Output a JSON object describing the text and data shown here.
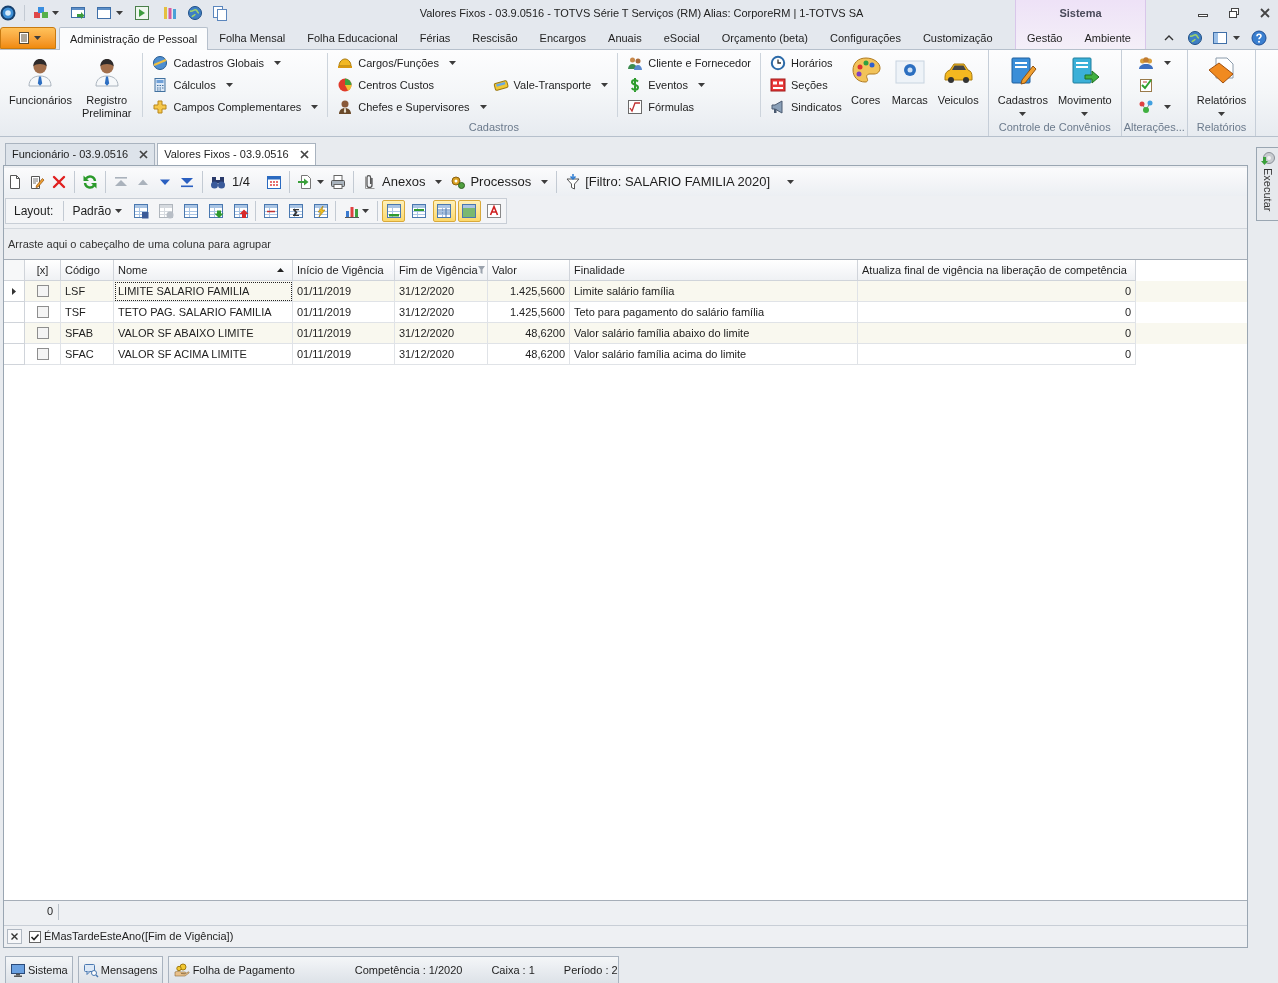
{
  "window": {
    "title": "Valores Fixos - 03.9.0516 - TOTVS Série T Serviços (RM) Alias: CorporeRM | 1-TOTVS SA"
  },
  "ribbon_tabs": [
    {
      "label": "Administração de Pessoal",
      "selected": true
    },
    {
      "label": "Folha Mensal",
      "selected": false
    },
    {
      "label": "Folha Educacional",
      "selected": false
    },
    {
      "label": "Férias",
      "selected": false
    },
    {
      "label": "Rescisão",
      "selected": false
    },
    {
      "label": "Encargos",
      "selected": false
    },
    {
      "label": "Anuais",
      "selected": false
    },
    {
      "label": "eSocial",
      "selected": false
    },
    {
      "label": "Orçamento (beta)",
      "selected": false
    },
    {
      "label": "Configurações",
      "selected": false
    },
    {
      "label": "Customização",
      "selected": false
    }
  ],
  "contextual_tab_group": {
    "label": "Sistema",
    "tabs": [
      {
        "label": "Gestão",
        "selected": false
      },
      {
        "label": "Ambiente",
        "selected": false
      }
    ]
  },
  "ribbon_groups": [
    {
      "label": "Cadastros",
      "columns": [
        {
          "kind": "large",
          "items": [
            {
              "label": "Funcionários",
              "dropdown": false
            }
          ]
        },
        {
          "kind": "large",
          "items": [
            {
              "label": "Registro Preliminar",
              "dropdown": false
            }
          ]
        },
        {
          "kind": "separator"
        },
        {
          "kind": "small",
          "items": [
            {
              "label": "Cadastros Globais",
              "dropdown": true
            },
            {
              "label": "Cálculos",
              "dropdown": true
            },
            {
              "label": "Campos Complementares",
              "dropdown": true
            }
          ]
        },
        {
          "kind": "separator"
        },
        {
          "kind": "small",
          "items": [
            {
              "label": "Cargos/Funções",
              "dropdown": true
            },
            {
              "label": "Centros Custos",
              "dropdown": false
            },
            {
              "label": "Chefes e Supervisores",
              "dropdown": true
            }
          ]
        },
        {
          "kind": "small",
          "items": [
            {
              "label": "Vale-Transporte",
              "dropdown": true
            }
          ]
        },
        {
          "kind": "separator"
        },
        {
          "kind": "small",
          "items": [
            {
              "label": "Cliente e Fornecedor",
              "dropdown": false
            },
            {
              "label": "Eventos",
              "dropdown": true
            },
            {
              "label": "Fórmulas",
              "dropdown": false
            }
          ]
        },
        {
          "kind": "separator"
        },
        {
          "kind": "small",
          "items": [
            {
              "label": "Horários",
              "dropdown": false
            },
            {
              "label": "Seções",
              "dropdown": false
            },
            {
              "label": "Sindicatos",
              "dropdown": false
            }
          ]
        },
        {
          "kind": "large",
          "items": [
            {
              "label": "Cores",
              "dropdown": false
            }
          ]
        },
        {
          "kind": "large",
          "items": [
            {
              "label": "Marcas",
              "dropdown": false
            }
          ]
        },
        {
          "kind": "large",
          "items": [
            {
              "label": "Veiculos",
              "dropdown": false
            }
          ]
        }
      ]
    },
    {
      "label": "Controle de Convênios",
      "columns": [
        {
          "kind": "large",
          "items": [
            {
              "label": "Cadastros",
              "dropdown": true
            }
          ]
        },
        {
          "kind": "large",
          "items": [
            {
              "label": "Movimento",
              "dropdown": true
            }
          ]
        }
      ]
    },
    {
      "label": "Alterações...",
      "columns": [
        {
          "kind": "small",
          "items": [
            {
              "dropdown": true
            },
            {
              "dropdown": false
            },
            {
              "dropdown": true
            }
          ]
        }
      ]
    },
    {
      "label": "Relatórios",
      "columns": [
        {
          "kind": "large",
          "items": [
            {
              "label": "Relatórios",
              "dropdown": true
            }
          ]
        }
      ]
    }
  ],
  "document_tabs": [
    {
      "label": "Funcionário - 03.9.0516",
      "selected": false
    },
    {
      "label": "Valores Fixos - 03.9.0516",
      "selected": true
    }
  ],
  "toolbar": {
    "navigation": [
      {
        "disabled": true
      },
      {
        "disabled": true
      },
      {
        "disabled": false
      },
      {
        "disabled": false
      }
    ],
    "record_position": "1/4",
    "menus": [
      {
        "label": "Anexos"
      },
      {
        "label": "Processos"
      }
    ],
    "filter": {
      "label": "[Filtro: SALARIO FAMILIA 2020]"
    }
  },
  "layout_toolbar": {
    "label": "Layout:",
    "layout_menu": "Padrão",
    "tools": [
      {
        "disabled": false
      },
      {
        "disabled": true
      },
      {
        "disabled": false
      },
      {
        "disabled": false
      },
      {
        "disabled": false
      }
    ],
    "view_toggles": [
      {
        "on": true
      },
      {
        "on": false
      },
      {
        "on": true
      },
      {
        "on": true
      },
      {
        "on": false
      }
    ]
  },
  "group_panel": {
    "hint": "Arraste aqui o cabeçalho de uma coluna para agrupar"
  },
  "grid": {
    "checkbox_column": {
      "label": "[x]"
    },
    "columns": [
      {
        "label": "Código",
        "sorted": false,
        "filtered": false
      },
      {
        "label": "Nome",
        "sorted": true,
        "filtered": false
      },
      {
        "label": "Início de Vigência",
        "sorted": false,
        "filtered": false
      },
      {
        "label": "Fim de Vigência",
        "sorted": false,
        "filtered": true
      },
      {
        "label": "Valor",
        "sorted": false,
        "filtered": false
      },
      {
        "label": "Finalidade",
        "sorted": false,
        "filtered": false
      },
      {
        "label": "Atualiza final de vigência na liberação de competência",
        "sorted": false,
        "filtered": false
      }
    ],
    "rows": [
      {
        "selected": true,
        "checked": false,
        "cells": [
          {
            "text": "LSF",
            "focused": false
          },
          {
            "text": "LIMITE SALARIO FAMILIA",
            "focused": true
          },
          {
            "text": "01/11/2019",
            "focused": false
          },
          {
            "text": "31/12/2020",
            "focused": false
          },
          {
            "text": "1.425,5600",
            "focused": false
          },
          {
            "text": "Limite salário família",
            "focused": false
          },
          {
            "text": "0",
            "focused": false
          }
        ]
      },
      {
        "selected": false,
        "checked": false,
        "cells": [
          {
            "text": "TSF",
            "focused": false
          },
          {
            "text": "TETO PAG. SALARIO FAMILIA",
            "focused": false
          },
          {
            "text": "01/11/2019",
            "focused": false
          },
          {
            "text": "31/12/2020",
            "focused": false
          },
          {
            "text": "1.425,5600",
            "focused": false
          },
          {
            "text": "Teto para pagamento do salário família",
            "focused": false
          },
          {
            "text": "0",
            "focused": false
          }
        ]
      },
      {
        "selected": false,
        "checked": false,
        "cells": [
          {
            "text": "SFAB",
            "focused": false
          },
          {
            "text": "VALOR SF ABAIXO LIMITE",
            "focused": false
          },
          {
            "text": "01/11/2019",
            "focused": false
          },
          {
            "text": "31/12/2020",
            "focused": false
          },
          {
            "text": "48,6200",
            "focused": false
          },
          {
            "text": "Valor salário família abaixo do limite",
            "focused": false
          },
          {
            "text": "0",
            "focused": false
          }
        ]
      },
      {
        "selected": false,
        "checked": false,
        "cells": [
          {
            "text": "SFAC",
            "focused": false
          },
          {
            "text": "VALOR SF ACIMA LIMITE",
            "focused": false
          },
          {
            "text": "01/11/2019",
            "focused": false
          },
          {
            "text": "31/12/2020",
            "focused": false
          },
          {
            "text": "48,6200",
            "focused": false
          },
          {
            "text": "Valor salário família acima do limite",
            "focused": false
          },
          {
            "text": "0",
            "focused": false
          }
        ]
      }
    ],
    "footer": "0"
  },
  "filter_panel": {
    "enabled": true,
    "expression": "ÉMasTardeEsteAno([Fim de Vigência])"
  },
  "side_tabs": [
    {
      "label": "Executar"
    }
  ],
  "status_bar": {
    "buttons": [
      {
        "label": "Sistema"
      },
      {
        "label": "Mensagens"
      }
    ],
    "module": "Folha de Pagamento",
    "fields": [
      "Competência : 1/2020",
      "Caixa : 1",
      "Período : 2"
    ]
  }
}
